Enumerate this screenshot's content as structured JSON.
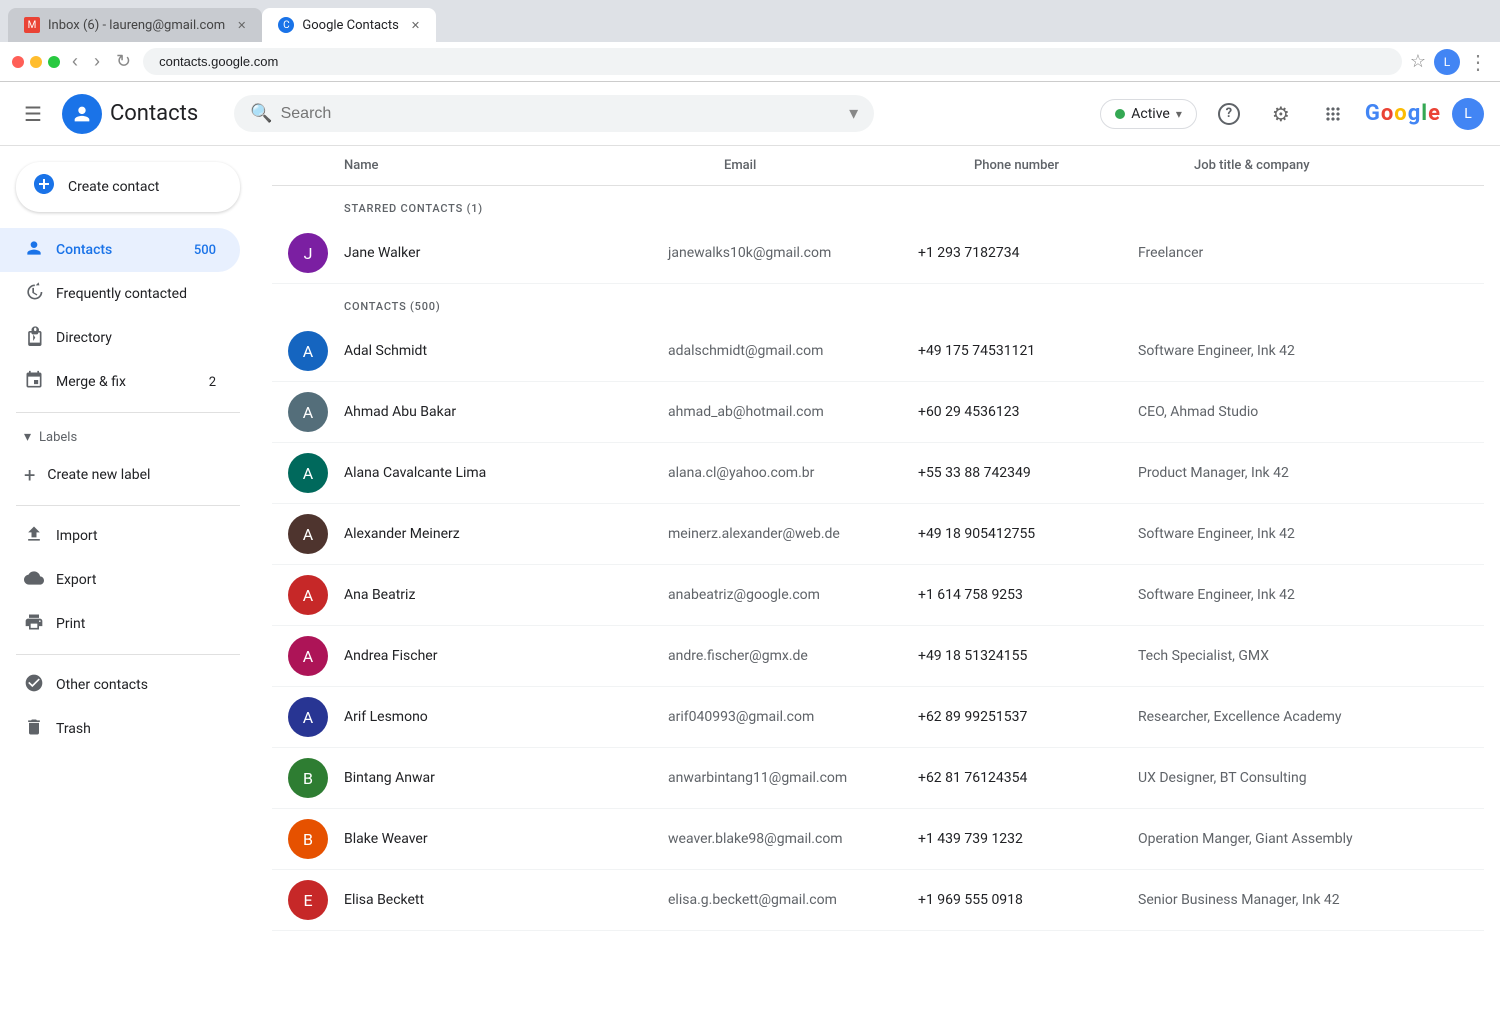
{
  "browser": {
    "tabs": [
      {
        "id": "tab-gmail",
        "label": "Inbox (6) - laureng@gmail.com",
        "favicon": "M",
        "favicon_color": "#ea4335",
        "active": false
      },
      {
        "id": "tab-contacts",
        "label": "Google Contacts",
        "favicon": "C",
        "favicon_color": "#1a73e8",
        "active": true
      }
    ],
    "url": "contacts.google.com"
  },
  "header": {
    "menu_label": "☰",
    "logo_char": "✦",
    "app_title": "Contacts",
    "search_placeholder": "Search",
    "active_label": "Active",
    "active_chevron": "▾",
    "help_icon": "?",
    "settings_icon": "⚙",
    "apps_icon": "⠿",
    "google_logo": [
      "G",
      "o",
      "o",
      "g",
      "l",
      "e"
    ],
    "user_initial": "L"
  },
  "sidebar": {
    "create_contact_label": "Create contact",
    "items": [
      {
        "id": "contacts",
        "label": "Contacts",
        "icon": "👤",
        "count": "500",
        "active": true
      },
      {
        "id": "frequently-contacted",
        "label": "Frequently contacted",
        "icon": "🕐",
        "count": "",
        "active": false
      },
      {
        "id": "directory",
        "label": "Directory",
        "icon": "⊞",
        "count": "",
        "active": false
      },
      {
        "id": "merge-fix",
        "label": "Merge & fix",
        "icon": "⊕",
        "count": "2",
        "active": false
      }
    ],
    "labels_section": "Labels",
    "create_label": "Create new label",
    "footer_items": [
      {
        "id": "import",
        "label": "Import",
        "icon": "↑"
      },
      {
        "id": "export",
        "label": "Export",
        "icon": "☁"
      },
      {
        "id": "print",
        "label": "Print",
        "icon": "🖨"
      }
    ],
    "other_contacts": "Other contacts",
    "trash": "Trash"
  },
  "table": {
    "headers": [
      "Name",
      "Email",
      "Phone number",
      "Job title & company"
    ],
    "starred_section_label": "STARRED CONTACTS (1)",
    "contacts_section_label": "CONTACTS (500)",
    "starred_contacts": [
      {
        "name": "Jane Walker",
        "email": "janewalks10k@gmail.com",
        "phone": "+1 293 7182734",
        "job": "Freelancer",
        "avatar_color": "av-purple",
        "avatar_initial": "J"
      }
    ],
    "contacts": [
      {
        "name": "Adal Schmidt",
        "email": "adalschmidt@gmail.com",
        "phone": "+49 175 74531121",
        "job": "Software Engineer, Ink 42",
        "avatar_color": "av-blue",
        "avatar_initial": "A"
      },
      {
        "name": "Ahmad Abu Bakar",
        "email": "ahmad_ab@hotmail.com",
        "phone": "+60 29 4536123",
        "job": "CEO, Ahmad Studio",
        "avatar_color": "av-gray",
        "avatar_initial": "A"
      },
      {
        "name": "Alana Cavalcante Lima",
        "email": "alana.cl@yahoo.com.br",
        "phone": "+55 33 88 742349",
        "job": "Product Manager, Ink 42",
        "avatar_color": "av-teal",
        "avatar_initial": "A"
      },
      {
        "name": "Alexander Meinerz",
        "email": "meinerz.alexander@web.de",
        "phone": "+49 18 905412755",
        "job": "Software Engineer, Ink 42",
        "avatar_color": "av-brown",
        "avatar_initial": "A"
      },
      {
        "name": "Ana Beatriz",
        "email": "anabeatriz@google.com",
        "phone": "+1 614 758 9253",
        "job": "Software Engineer, Ink 42",
        "avatar_color": "av-red",
        "avatar_initial": "A"
      },
      {
        "name": "Andrea Fischer",
        "email": "andre.fischer@gmx.de",
        "phone": "+49 18 51324155",
        "job": "Tech Specialist, GMX",
        "avatar_color": "av-pink",
        "avatar_initial": "A"
      },
      {
        "name": "Arif Lesmono",
        "email": "arif040993@gmail.com",
        "phone": "+62 89 99251537",
        "job": "Researcher, Excellence Academy",
        "avatar_color": "av-indigo",
        "avatar_initial": "A"
      },
      {
        "name": "Bintang Anwar",
        "email": "anwarbintang11@gmail.com",
        "phone": "+62 81 76124354",
        "job": "UX Designer, BT Consulting",
        "avatar_color": "av-green",
        "avatar_initial": "B"
      },
      {
        "name": "Blake Weaver",
        "email": "weaver.blake98@gmail.com",
        "phone": "+1 439 739 1232",
        "job": "Operation Manger, Giant Assembly",
        "avatar_color": "av-orange",
        "avatar_initial": "B"
      },
      {
        "name": "Elisa Beckett",
        "email": "elisa.g.beckett@gmail.com",
        "phone": "+1 969 555 0918",
        "job": "Senior Business Manager, Ink 42",
        "avatar_color": "av-red",
        "avatar_initial": "E"
      }
    ]
  }
}
